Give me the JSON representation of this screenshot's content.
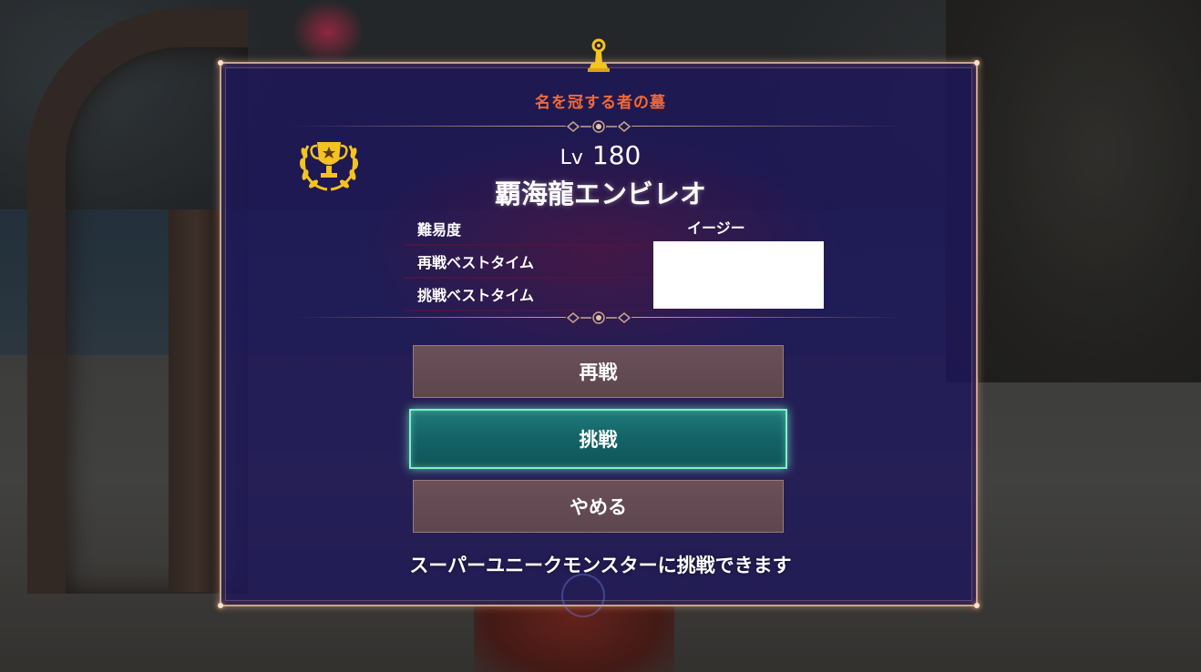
{
  "dialog": {
    "title": "名を冠する者の墓",
    "level_prefix": "Lv",
    "level": "180",
    "monster_name": "覇海龍エンビレオ",
    "stats": [
      {
        "label": "難易度",
        "value": "イージー"
      },
      {
        "label": "再戦ベストタイム",
        "value": ""
      },
      {
        "label": "挑戦ベストタイム",
        "value": ""
      }
    ],
    "buttons": {
      "rematch": "再戦",
      "challenge": "挑戦",
      "quit": "やめる"
    },
    "selected_button": "challenge",
    "footer_message": "スーパーユニークモンスターに挑戦できます"
  },
  "icons": {
    "emblem": "gold-pawn-emblem-icon",
    "trophy": "gold-trophy-laurel-icon",
    "divider": "ornament-icon"
  },
  "colors": {
    "title": "#f06a3a",
    "panel": "#1e165c",
    "border": "#c9a48a",
    "button_normal": "#5e464f",
    "button_active": "#146366",
    "button_active_glow": "#7ff0c8",
    "trophy_gold": "#f5c320"
  }
}
